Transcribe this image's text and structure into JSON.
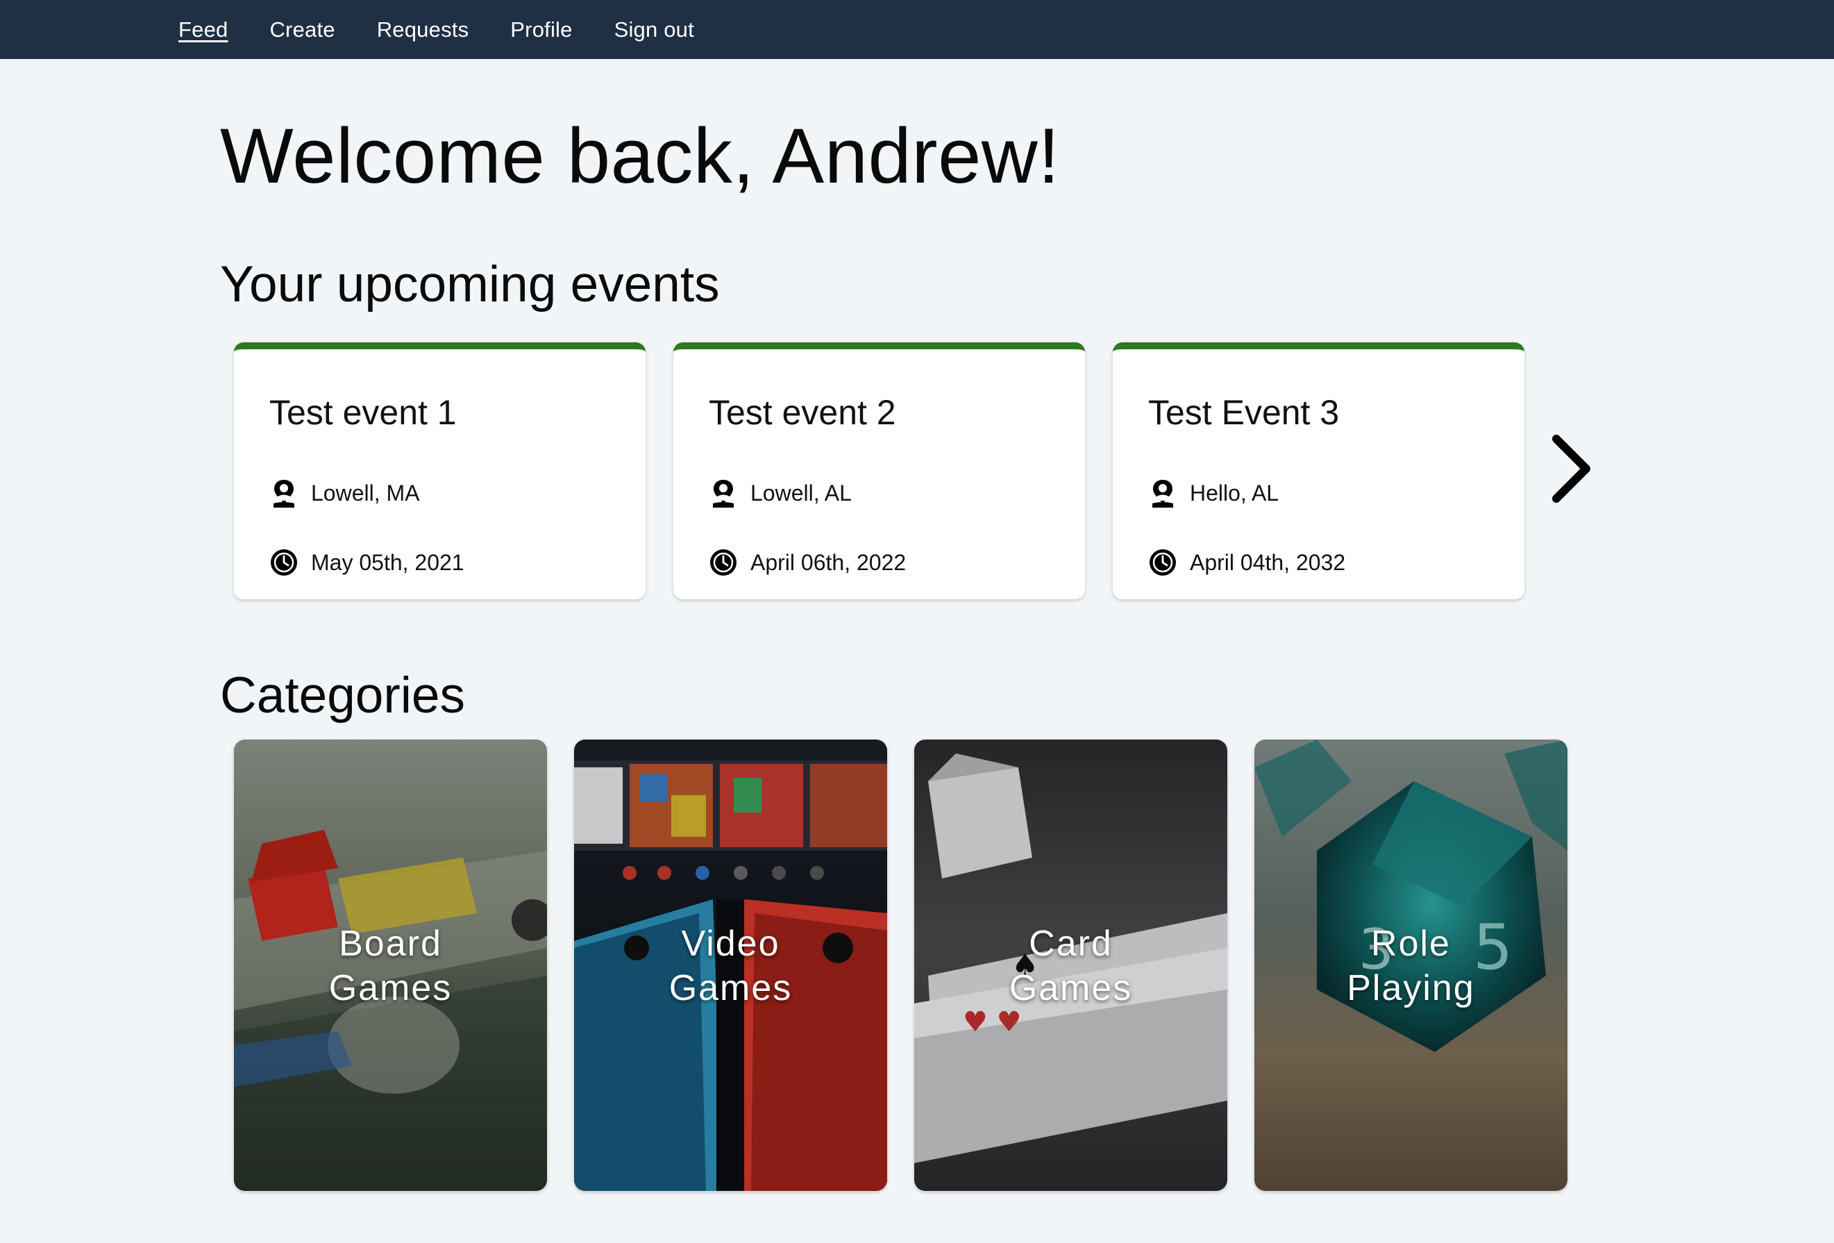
{
  "nav": {
    "items": [
      {
        "label": "Feed",
        "active": true
      },
      {
        "label": "Create",
        "active": false
      },
      {
        "label": "Requests",
        "active": false
      },
      {
        "label": "Profile",
        "active": false
      },
      {
        "label": "Sign out",
        "active": false
      }
    ]
  },
  "welcome": "Welcome back, Andrew!",
  "upcoming": {
    "title": "Your upcoming events",
    "events": [
      {
        "title": "Test event 1",
        "location": "Lowell, MA",
        "date": "May 05th, 2021"
      },
      {
        "title": "Test event 2",
        "location": "Lowell, AL",
        "date": "April 06th, 2022"
      },
      {
        "title": "Test Event 3",
        "location": "Hello, AL",
        "date": "April 04th, 2032"
      }
    ],
    "next_icon": "chevron-right-icon"
  },
  "categories": {
    "title": "Categories",
    "items": [
      {
        "line1": "Board",
        "line2": "Games"
      },
      {
        "line1": "Video",
        "line2": "Games"
      },
      {
        "line1": "Card",
        "line2": "Games"
      },
      {
        "line1": "Role",
        "line2": "Playing"
      }
    ]
  },
  "colors": {
    "nav_bg": "#1f3045",
    "page_bg": "#f2f5f8",
    "card_accent": "#2c7a1f"
  }
}
